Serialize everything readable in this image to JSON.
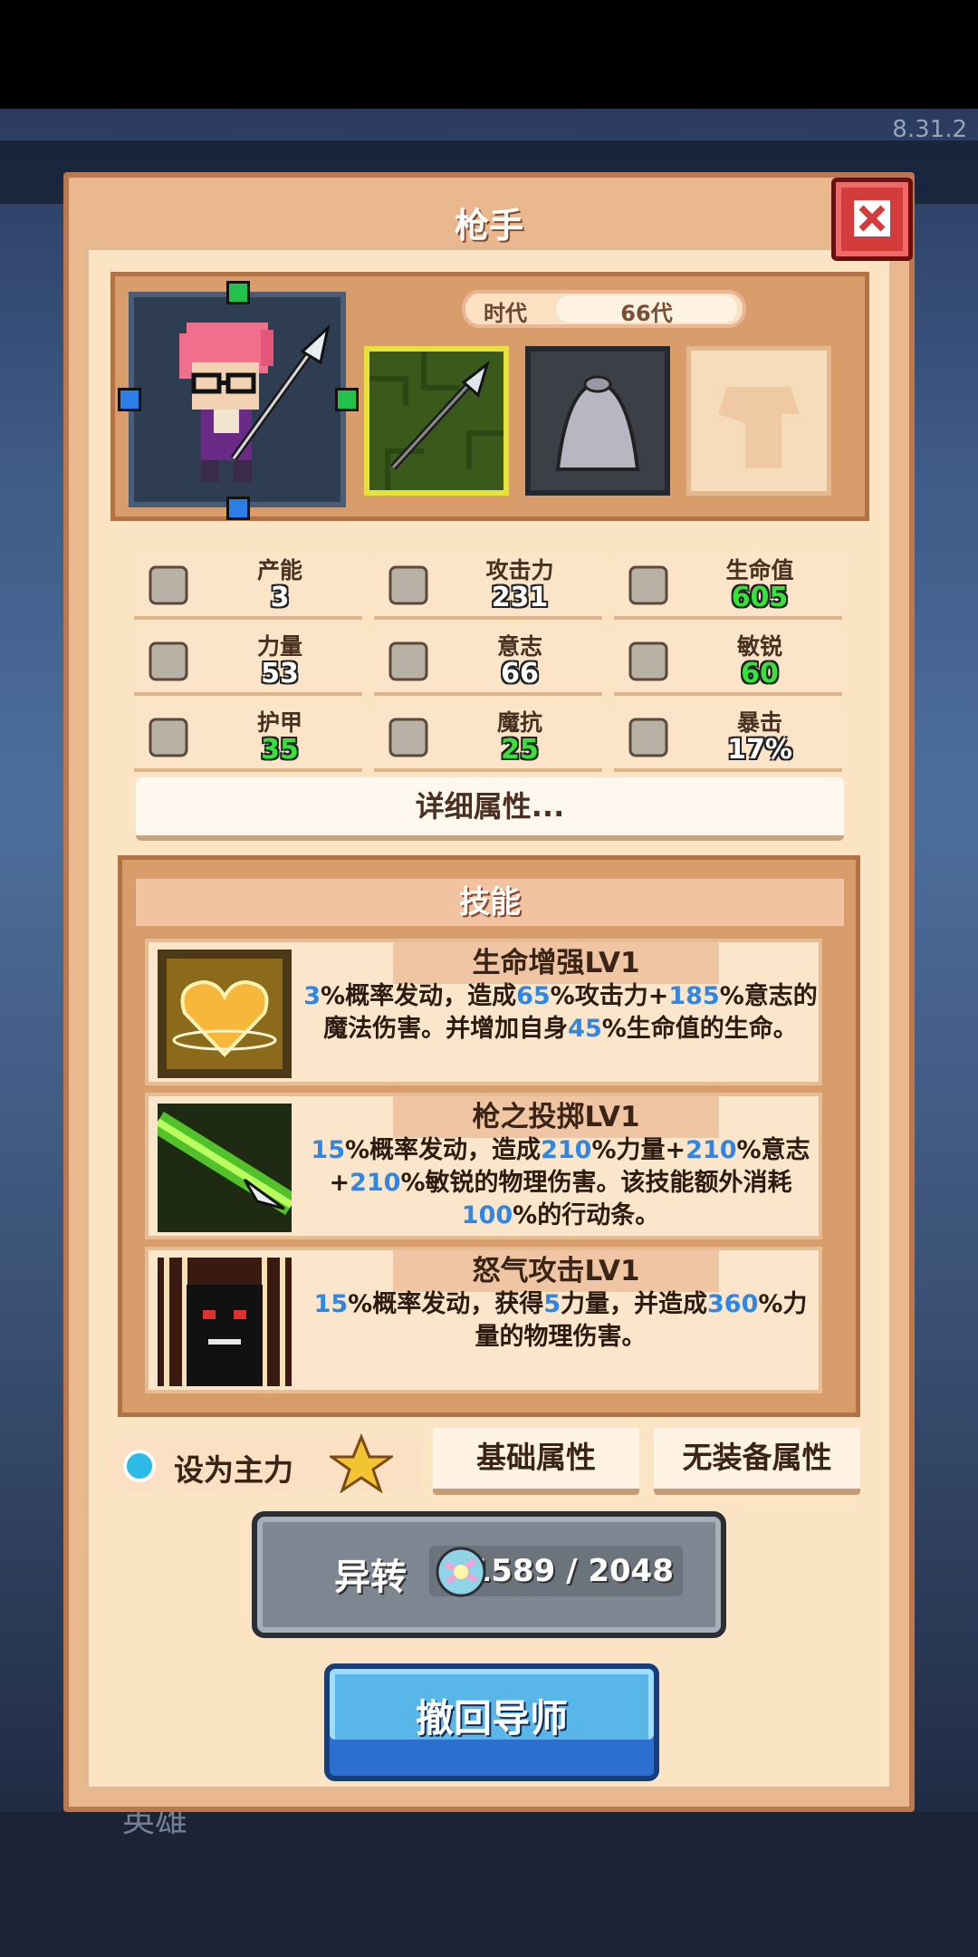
{
  "version": "8.31.2",
  "background": {
    "hero_label": "英雄"
  },
  "dialog": {
    "title": "枪手",
    "close_icon": "close-icon",
    "era": {
      "label": "时代",
      "value": "66代"
    }
  },
  "stats": [
    {
      "label": "产能",
      "value": "3",
      "green": false,
      "icon": "production-icon"
    },
    {
      "label": "攻击力",
      "value": "231",
      "green": false,
      "icon": "sword-icon"
    },
    {
      "label": "生命值",
      "value": "605",
      "green": true,
      "icon": "health-cross-icon"
    },
    {
      "label": "力量",
      "value": "53",
      "green": false,
      "icon": "strength-icon"
    },
    {
      "label": "意志",
      "value": "66",
      "green": false,
      "icon": "will-icon"
    },
    {
      "label": "敏锐",
      "value": "60",
      "green": true,
      "icon": "agility-icon"
    },
    {
      "label": "护甲",
      "value": "35",
      "green": true,
      "icon": "armor-icon"
    },
    {
      "label": "魔抗",
      "value": "25",
      "green": true,
      "icon": "magic-resist-icon"
    },
    {
      "label": "暴击",
      "value": "17%",
      "green": false,
      "icon": "crit-icon"
    }
  ],
  "detail_button": "详细属性...",
  "skills": {
    "title": "技能",
    "items": [
      {
        "name": "生命增强LV1",
        "desc_parts": [
          "3",
          "%概率发动，造成",
          "65",
          "%攻击力+",
          "185",
          "%意志的魔法伤害。并增加自身",
          "45",
          "%生命值的生命。"
        ]
      },
      {
        "name": "枪之投掷LV1",
        "desc_parts": [
          "15",
          "%概率发动，造成",
          "210",
          "%力量+",
          "210",
          "%意志+",
          "210",
          "%敏锐的物理伤害。该技能额外消耗",
          "100",
          "%的行动条。"
        ]
      },
      {
        "name": "怒气攻击LV1",
        "desc_parts": [
          "15",
          "%概率发动，获得",
          "5",
          "力量，并造成",
          "360",
          "%力量的物理伤害。"
        ]
      }
    ]
  },
  "bottom": {
    "set_main_label": "设为主力",
    "tab_basic": "基础属性",
    "tab_no_equip": "无装备属性",
    "transmute_label": "异转",
    "transmute_count": "1589 / 2048",
    "recall_label": "撤回导师"
  }
}
